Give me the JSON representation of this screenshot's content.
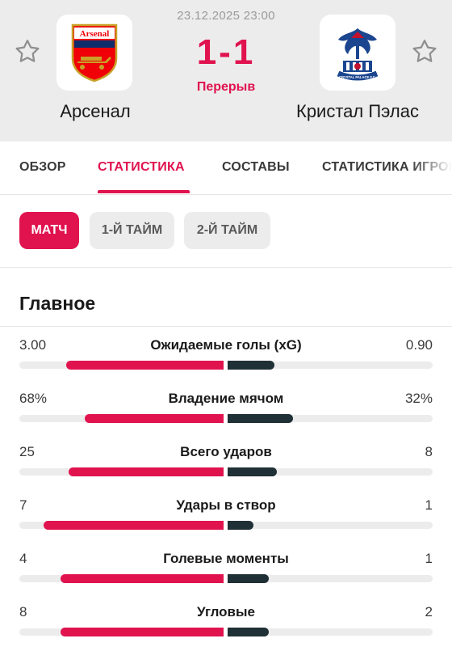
{
  "match": {
    "datetime": "23.12.2025 23:00",
    "score": "1-1",
    "status": "Перерыв",
    "home": {
      "name": "Арсенал",
      "crest_text": "Arsenal"
    },
    "away": {
      "name": "Кристал Пэлас",
      "crest_text": "CRYSTAL PALACE F.C."
    }
  },
  "tabs": [
    {
      "label": "ОБЗОР",
      "active": false
    },
    {
      "label": "СТАТИСТИКА",
      "active": true
    },
    {
      "label": "СОСТАВЫ",
      "active": false
    },
    {
      "label": "СТАТИСТИКА ИГРОКОВ",
      "active": false
    }
  ],
  "periods": [
    {
      "label": "МАТЧ",
      "active": true
    },
    {
      "label": "1-Й ТАЙМ",
      "active": false
    },
    {
      "label": "2-Й ТАЙМ",
      "active": false
    }
  ],
  "section": {
    "title": "Главное"
  },
  "stats": [
    {
      "label": "Ожидаемые голы (xG)",
      "home": "3.00",
      "away": "0.90",
      "home_share": 0.77,
      "away_share": 0.23
    },
    {
      "label": "Владение мячом",
      "home": "68%",
      "away": "32%",
      "home_share": 0.68,
      "away_share": 0.32
    },
    {
      "label": "Всего ударов",
      "home": "25",
      "away": "8",
      "home_share": 0.76,
      "away_share": 0.24
    },
    {
      "label": "Удары в створ",
      "home": "7",
      "away": "1",
      "home_share": 0.88,
      "away_share": 0.125
    },
    {
      "label": "Голевые моменты",
      "home": "4",
      "away": "1",
      "home_share": 0.8,
      "away_share": 0.2
    },
    {
      "label": "Угловые",
      "home": "8",
      "away": "2",
      "home_share": 0.8,
      "away_share": 0.2
    }
  ],
  "colors": {
    "accent": "#e0134f",
    "away_bar": "#1f3036",
    "track": "#ececec"
  },
  "icons": {
    "favorite": "star-outline-icon"
  }
}
